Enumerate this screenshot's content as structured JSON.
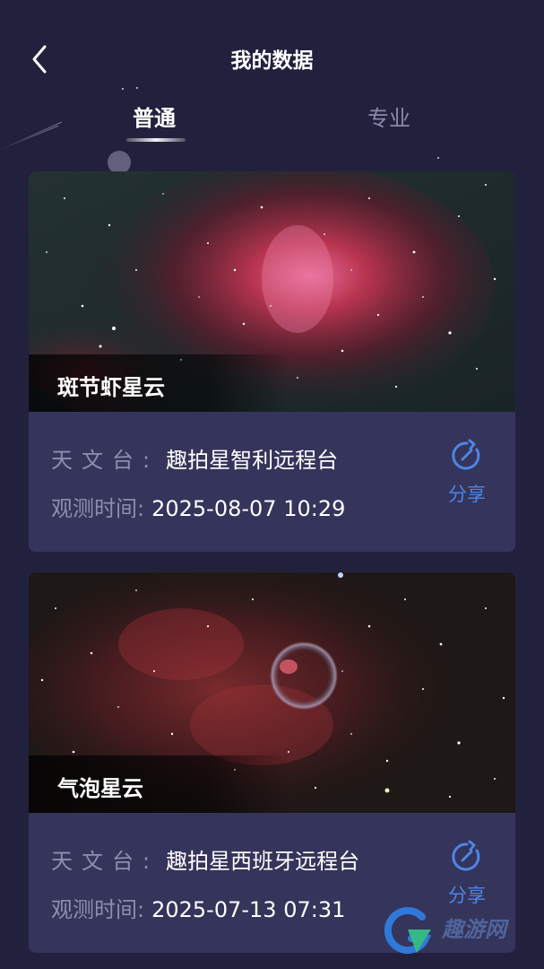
{
  "header": {
    "title": "我的数据"
  },
  "tabs": [
    {
      "label": "普通",
      "active": true
    },
    {
      "label": "专业",
      "active": false
    }
  ],
  "labels": {
    "observatory": "天文台:",
    "obs_time": "观测时间:",
    "share": "分享"
  },
  "cards": [
    {
      "name": "斑节虾星云",
      "observatory": "趣拍星智利远程台",
      "time": "2025-08-07 10:29"
    },
    {
      "name": "气泡星云",
      "observatory": "趣拍星西班牙远程台",
      "time": "2025-07-13 07:31"
    }
  ],
  "watermark": {
    "text": "趣游网"
  },
  "colors": {
    "background": "#22213d",
    "card": "#35345a",
    "accent": "#4d86e8",
    "label": "#8f8eb0"
  }
}
